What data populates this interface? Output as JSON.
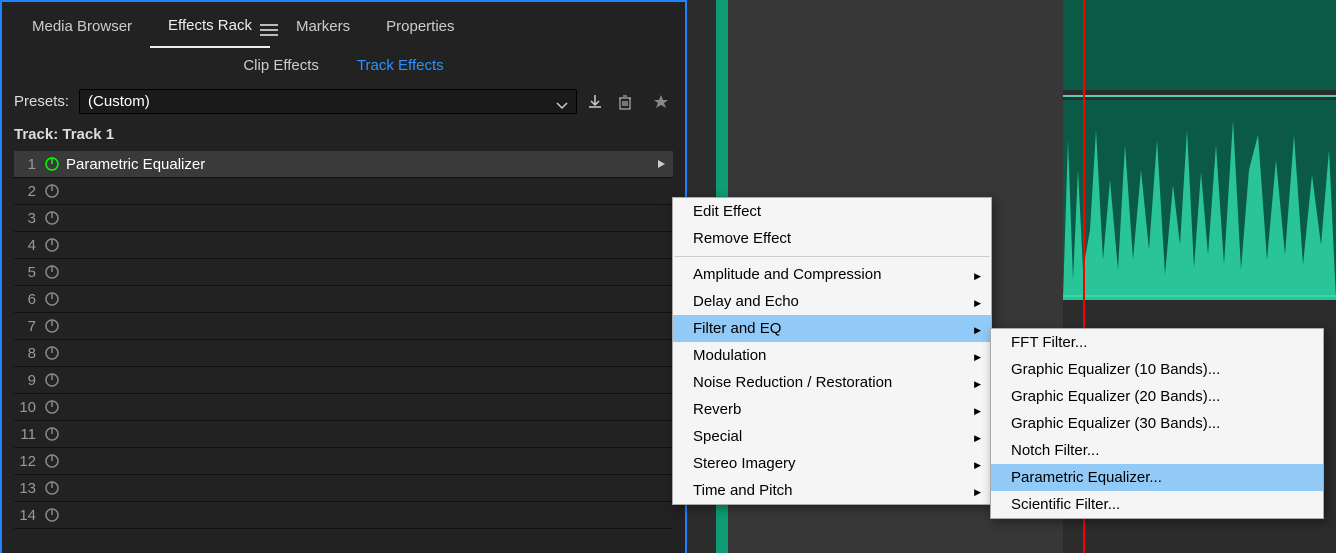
{
  "tabs": {
    "media": "Media Browser",
    "effects": "Effects Rack",
    "markers": "Markers",
    "properties": "Properties"
  },
  "subtabs": {
    "clip": "Clip Effects",
    "track": "Track Effects"
  },
  "presets": {
    "label": "Presets:",
    "value": "(Custom)"
  },
  "track_label": "Track: Track 1",
  "slots": [
    {
      "n": "1",
      "name": "Parametric Equalizer",
      "on": true,
      "hasPlay": true
    },
    {
      "n": "2",
      "name": "",
      "on": false
    },
    {
      "n": "3",
      "name": "",
      "on": false
    },
    {
      "n": "4",
      "name": "",
      "on": false
    },
    {
      "n": "5",
      "name": "",
      "on": false
    },
    {
      "n": "6",
      "name": "",
      "on": false
    },
    {
      "n": "7",
      "name": "",
      "on": false
    },
    {
      "n": "8",
      "name": "",
      "on": false
    },
    {
      "n": "9",
      "name": "",
      "on": false
    },
    {
      "n": "10",
      "name": "",
      "on": false
    },
    {
      "n": "11",
      "name": "",
      "on": false
    },
    {
      "n": "12",
      "name": "",
      "on": false
    },
    {
      "n": "13",
      "name": "",
      "on": false
    },
    {
      "n": "14",
      "name": "",
      "on": false
    }
  ],
  "menu": {
    "edit": "Edit Effect",
    "remove": "Remove Effect",
    "amp": "Amplitude and Compression",
    "delay": "Delay and Echo",
    "filter": "Filter and EQ",
    "mod": "Modulation",
    "noise": "Noise Reduction / Restoration",
    "reverb": "Reverb",
    "special": "Special",
    "stereo": "Stereo Imagery",
    "time": "Time and Pitch"
  },
  "submenu": {
    "fft": "FFT Filter...",
    "g10": "Graphic Equalizer (10 Bands)...",
    "g20": "Graphic Equalizer (20 Bands)...",
    "g30": "Graphic Equalizer (30 Bands)...",
    "notch": "Notch Filter...",
    "param": "Parametric Equalizer...",
    "sci": "Scientific Filter..."
  }
}
